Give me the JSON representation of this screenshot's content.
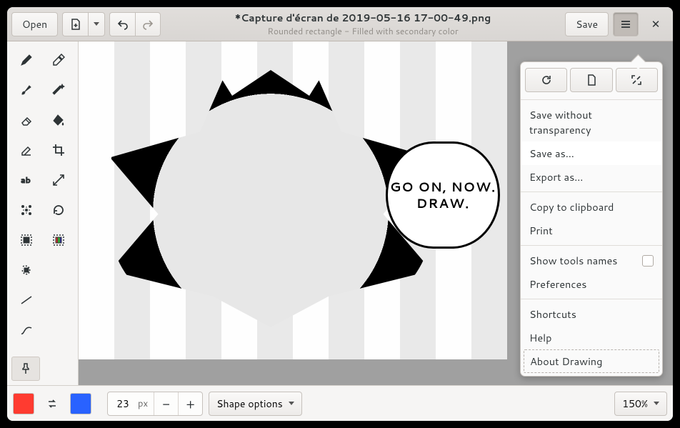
{
  "header": {
    "open": "Open",
    "title": "*Capture d'écran de 2019-05-16 17-00-49.png",
    "subtitle": "Rounded rectangle - Filled with secondary color",
    "save": "Save"
  },
  "speech": "GO ON, NOW. DRAW.",
  "bottom": {
    "primary": "#ff3b30",
    "secondary": "#2962ff",
    "size": "23",
    "unit": "px",
    "shape_options": "Shape options",
    "zoom": "150%"
  },
  "menu": {
    "save_no_alpha": "Save without transparency",
    "save_as": "Save as…",
    "export_as": "Export as…",
    "copy": "Copy to clipboard",
    "print": "Print",
    "show_names": "Show tools names",
    "prefs": "Preferences",
    "shortcuts": "Shortcuts",
    "help": "Help",
    "about": "About Drawing"
  }
}
